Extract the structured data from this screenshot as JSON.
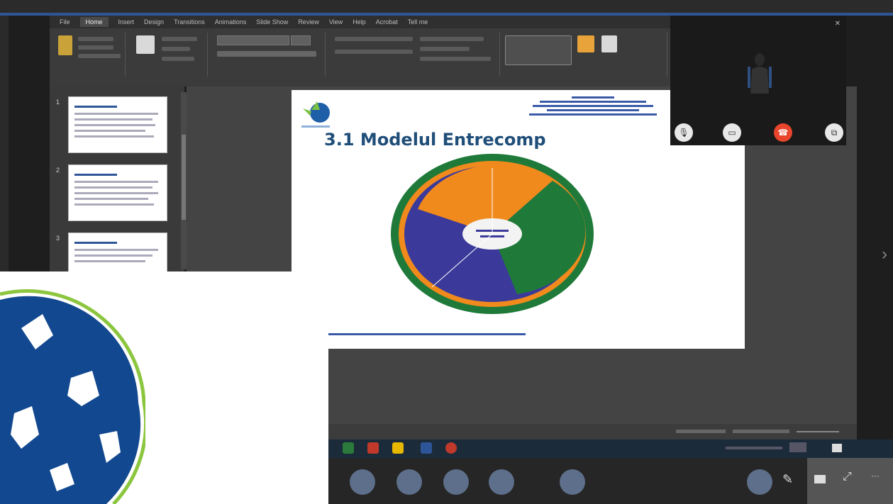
{
  "window": {
    "title_bar": "",
    "account": ""
  },
  "ribbon": {
    "tabs": [
      "File",
      "Home",
      "Insert",
      "Design",
      "Transitions",
      "Animations",
      "Slide Show",
      "Review",
      "View",
      "Help",
      "Acrobat",
      "Tell me"
    ],
    "active_tab": "Home"
  },
  "slides": {
    "thumbnail_numbers": [
      "1",
      "2",
      "3"
    ]
  },
  "slide": {
    "title": "3.1 Modelul Entrecomp"
  },
  "colors": {
    "accent_blue": "#2e5597",
    "wheel_green": "#1f7a3a",
    "wheel_orange": "#f08a1c",
    "wheel_purple": "#3b3a9a",
    "end_call_red": "#e8452c",
    "globe_blue": "#12488f",
    "globe_ring": "#8cc63f"
  },
  "video_call": {
    "controls": [
      "mic-icon",
      "camera-icon",
      "end-call-icon",
      "share-icon"
    ]
  }
}
